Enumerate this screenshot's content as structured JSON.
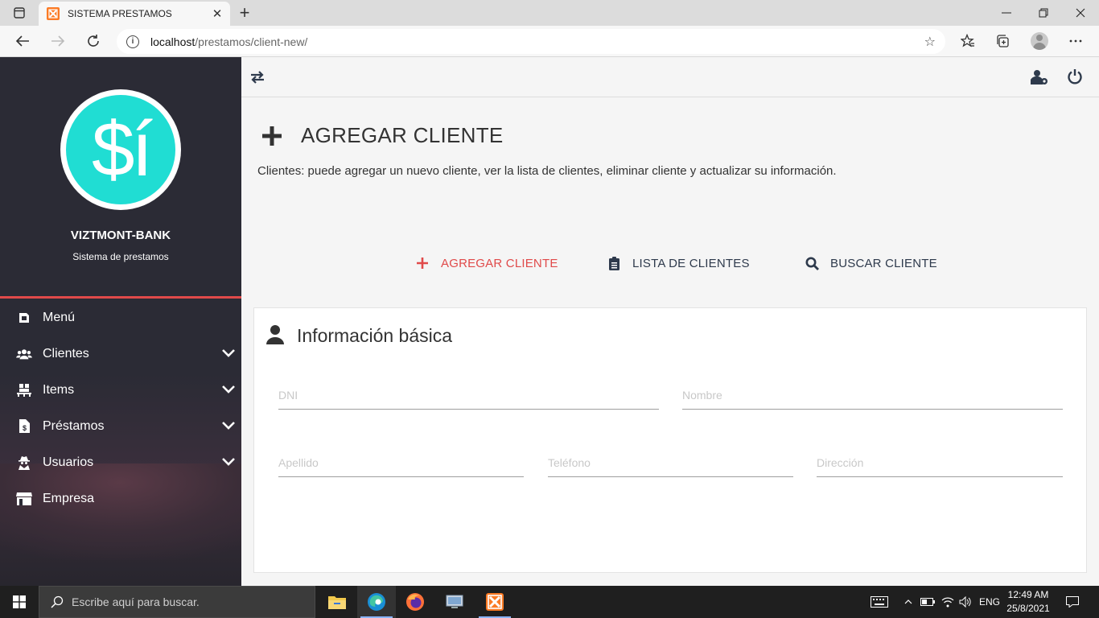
{
  "browser": {
    "tab_title": "SISTEMA PRESTAMOS",
    "url_host": "localhost",
    "url_path": "/prestamos/client-new/"
  },
  "sidebar": {
    "logo_text": "$í",
    "bank_name": "VIZTMONT-BANK",
    "bank_subtitle": "Sistema de prestamos",
    "items": [
      {
        "label": "Menú",
        "icon": "dashboard-icon",
        "expandable": false
      },
      {
        "label": "Clientes",
        "icon": "users-icon",
        "expandable": true
      },
      {
        "label": "Items",
        "icon": "pallet-icon",
        "expandable": true
      },
      {
        "label": "Préstamos",
        "icon": "invoice-dollar-icon",
        "expandable": true
      },
      {
        "label": "Usuarios",
        "icon": "user-secret-icon",
        "expandable": true
      },
      {
        "label": "Empresa",
        "icon": "store-icon",
        "expandable": false
      }
    ]
  },
  "page": {
    "title": "AGREGAR CLIENTE",
    "description": "Clientes: puede agregar un nuevo cliente, ver la lista de clientes, eliminar cliente y actualizar su información.",
    "actions": [
      {
        "label": "AGREGAR CLIENTE",
        "icon": "plus-icon",
        "active": true
      },
      {
        "label": "LISTA DE CLIENTES",
        "icon": "clipboard-list-icon",
        "active": false
      },
      {
        "label": "BUSCAR CLIENTE",
        "icon": "search-icon",
        "active": false
      }
    ]
  },
  "form": {
    "section_title": "Información básica",
    "fields": {
      "dni": {
        "placeholder": "DNI",
        "value": ""
      },
      "nombre": {
        "placeholder": "Nombre",
        "value": ""
      },
      "apellido": {
        "placeholder": "Apellido",
        "value": ""
      },
      "telefono": {
        "placeholder": "Teléfono",
        "value": ""
      },
      "direccion": {
        "placeholder": "Dirección",
        "value": ""
      }
    }
  },
  "taskbar": {
    "search_placeholder": "Escribe aquí para buscar.",
    "language": "ENG",
    "time": "12:49 AM",
    "date": "25/8/2021"
  },
  "colors": {
    "accent_red": "#e04a4a",
    "logo_teal": "#20ddd3",
    "sidebar_bg": "#2b2b35",
    "action_text": "#2e3a4c"
  }
}
